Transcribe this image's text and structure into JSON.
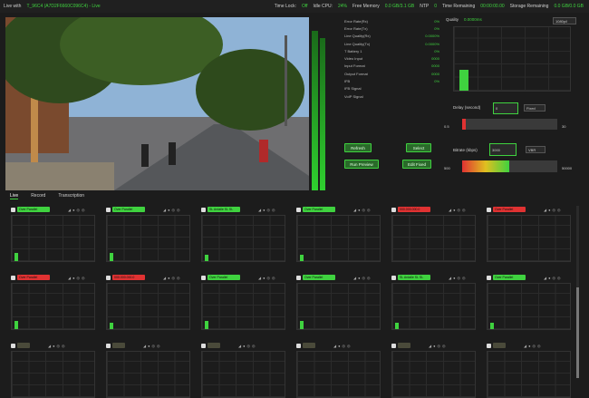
{
  "topbar": {
    "live_with": "Live with",
    "device": "T_96C4 (A7D2F6660C096C4) - Live",
    "time_lock_label": "Time Lock:",
    "time_lock_value": "Off",
    "idle_cpu_label": "Idle CPU:",
    "idle_cpu_value": "24%",
    "free_memory_label": "Free Memory",
    "free_memory_value": "0.0 GB/3.1 GB",
    "ntp_label": "NTP",
    "ntp_value": "0",
    "time_remaining_label": "Time Remaining",
    "time_remaining_value": "00:00:00.00",
    "storage_label": "Storage Remaining",
    "storage_value": "0.0 GB/0.0 GB"
  },
  "stats": [
    {
      "label": "Error Rate(Rx)",
      "value": "0%"
    },
    {
      "label": "Error Rate(Tx)",
      "value": "0%"
    },
    {
      "label": "Line Quality(Rx)",
      "value": "0.0000%"
    },
    {
      "label": "Line Quality(Tx)",
      "value": "0.0000%"
    },
    {
      "label": "T Battery 1",
      "value": "0%"
    },
    {
      "label": "Video Input",
      "value": "0000"
    },
    {
      "label": "Input Format",
      "value": "0000"
    },
    {
      "label": "Output Format",
      "value": "0000"
    },
    {
      "label": "IFB",
      "value": "0%"
    },
    {
      "label": "IFB Signal",
      "value": ""
    },
    {
      "label": "VoIP Signal",
      "value": ""
    }
  ],
  "buttons": {
    "refresh": "Refresh",
    "select": "Select",
    "run_preview": "Run Preview",
    "edit_fixed": "Edit Fixed"
  },
  "quality": {
    "title": "Quality",
    "subtitle": "0.0000ms",
    "dropdown": "1080p/i",
    "level": 0.33
  },
  "delay": {
    "label": "Delay (second)",
    "value": "0",
    "unit_option": "Fixed",
    "min": "0.5",
    "max": "30"
  },
  "bitrate": {
    "label": "Bitrate (kbps)",
    "value": "3000",
    "option": "VBR",
    "min": "500",
    "max": "50000"
  },
  "tabs": [
    "Live",
    "Record",
    "Transcription"
  ],
  "colors": {
    "accent": "#3fd23f",
    "red": "#e03232",
    "bg": "#1c1c1c"
  },
  "channels": [
    {
      "tag": "Over Parallel",
      "color": "green",
      "level": 0.18
    },
    {
      "tag": "Over Parallel",
      "color": "green",
      "level": 0.18
    },
    {
      "tag": "SL Ardalle SL SL",
      "color": "green",
      "level": 0.15
    },
    {
      "tag": "Over Parallel",
      "color": "green",
      "level": 0.15
    },
    {
      "tag": "000.000.000.0",
      "color": "red",
      "level": 0.0
    },
    {
      "tag": "Over Parallel",
      "color": "red",
      "level": 0.0
    },
    {
      "tag": "Over Parallel",
      "color": "red",
      "level": 0.18
    },
    {
      "tag": "000.000.000.0",
      "color": "red",
      "level": 0.15
    },
    {
      "tag": "Over Parallel",
      "color": "green",
      "level": 0.18
    },
    {
      "tag": "Over Parallel",
      "color": "green",
      "level": 0.18
    },
    {
      "tag": "SL Ardalle SL SL",
      "color": "green",
      "level": 0.15
    },
    {
      "tag": "Over Parallel",
      "color": "green",
      "level": 0.15
    },
    {
      "tag": "",
      "color": "gray",
      "level": 0.0
    },
    {
      "tag": "",
      "color": "gray",
      "level": 0.0
    },
    {
      "tag": "",
      "color": "gray",
      "level": 0.0
    },
    {
      "tag": "",
      "color": "gray",
      "level": 0.0
    },
    {
      "tag": "",
      "color": "gray",
      "level": 0.0
    },
    {
      "tag": "",
      "color": "gray",
      "level": 0.0
    }
  ]
}
